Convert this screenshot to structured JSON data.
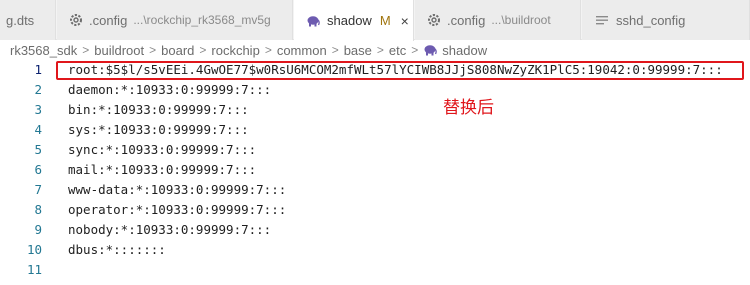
{
  "tabs": [
    {
      "label": "g.dts",
      "icon": "dts-file-icon"
    },
    {
      "label": ".config",
      "description": "...\\rockchip_rk3568_mv5g",
      "icon": "gear-icon"
    },
    {
      "label": "shadow",
      "modified": "M",
      "close": "×",
      "icon": "elephant-icon",
      "active": true
    },
    {
      "label": ".config",
      "description": "...\\buildroot",
      "icon": "gear-icon"
    },
    {
      "label": "sshd_config",
      "icon": "lines-icon"
    }
  ],
  "breadcrumb": [
    "rk3568_sdk",
    "buildroot",
    "board",
    "rockchip",
    "common",
    "base",
    "etc",
    "shadow"
  ],
  "breadcrumb_separator": ">",
  "editor": {
    "lines": [
      {
        "n": "1",
        "text": "root:$5$l/s5vEEi.4GwOE77$w0RsU6MCOM2mfWLt57lYCIWB8JJjS808NwZyZK1PlC5:19042:0:99999:7:::"
      },
      {
        "n": "2",
        "text": "daemon:*:10933:0:99999:7:::"
      },
      {
        "n": "3",
        "text": "bin:*:10933:0:99999:7:::"
      },
      {
        "n": "4",
        "text": "sys:*:10933:0:99999:7:::"
      },
      {
        "n": "5",
        "text": "sync:*:10933:0:99999:7:::"
      },
      {
        "n": "6",
        "text": "mail:*:10933:0:99999:7:::"
      },
      {
        "n": "7",
        "text": "www-data:*:10933:0:99999:7:::"
      },
      {
        "n": "8",
        "text": "operator:*:10933:0:99999:7:::"
      },
      {
        "n": "9",
        "text": "nobody:*:10933:0:99999:7:::"
      },
      {
        "n": "10",
        "text": "dbus:*:::::::"
      },
      {
        "n": "11",
        "text": ""
      }
    ]
  },
  "annotation": "替换后",
  "colors": {
    "annotation": "#e0161b",
    "modified": "#a0750f",
    "line_number": "#237893"
  }
}
